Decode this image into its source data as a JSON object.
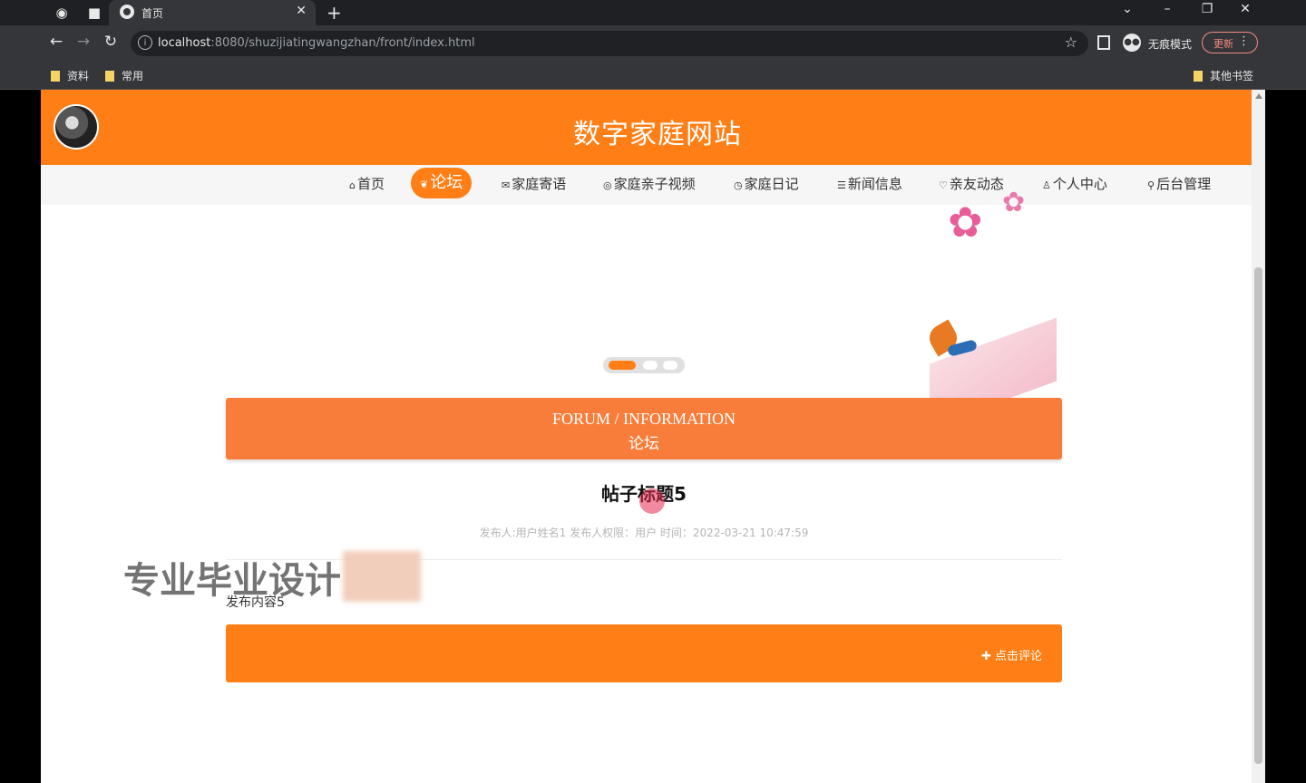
{
  "browser": {
    "tab_title": "首页",
    "url_host": "localhost",
    "url_rest": ":8080/shuzijiatingwangzhan/front/index.html",
    "incognito_label": "无痕模式",
    "update_label": "更新",
    "bookmarks": [
      "资料",
      "常用"
    ],
    "other_bookmarks": "其他书签"
  },
  "site": {
    "title": "数字家庭网站",
    "nav": [
      {
        "icon": "home-icon",
        "label": "首页"
      },
      {
        "icon": "forum-icon",
        "label": "论坛"
      },
      {
        "icon": "letter-icon",
        "label": "家庭寄语"
      },
      {
        "icon": "video-icon",
        "label": "家庭亲子视频"
      },
      {
        "icon": "diary-icon",
        "label": "家庭日记"
      },
      {
        "icon": "news-icon",
        "label": "新闻信息"
      },
      {
        "icon": "activity-icon",
        "label": "亲友动态"
      },
      {
        "icon": "user-icon",
        "label": "个人中心"
      },
      {
        "icon": "link-icon",
        "label": "后台管理"
      }
    ],
    "active_nav": "论坛"
  },
  "section": {
    "en": "FORUM / INFORMATION",
    "cn": "论坛"
  },
  "post": {
    "title": "帖子标题5",
    "meta": "发布人:用户姓名1   发布人权限：用户   时间：2022-03-21 10:47:59",
    "content": "发布内容5",
    "comment_button": "点击评论"
  },
  "overlay": {
    "watermark": "专业毕业设计"
  },
  "colors": {
    "brand_orange": "#ff7f16",
    "section_orange": "#f97d3a"
  }
}
